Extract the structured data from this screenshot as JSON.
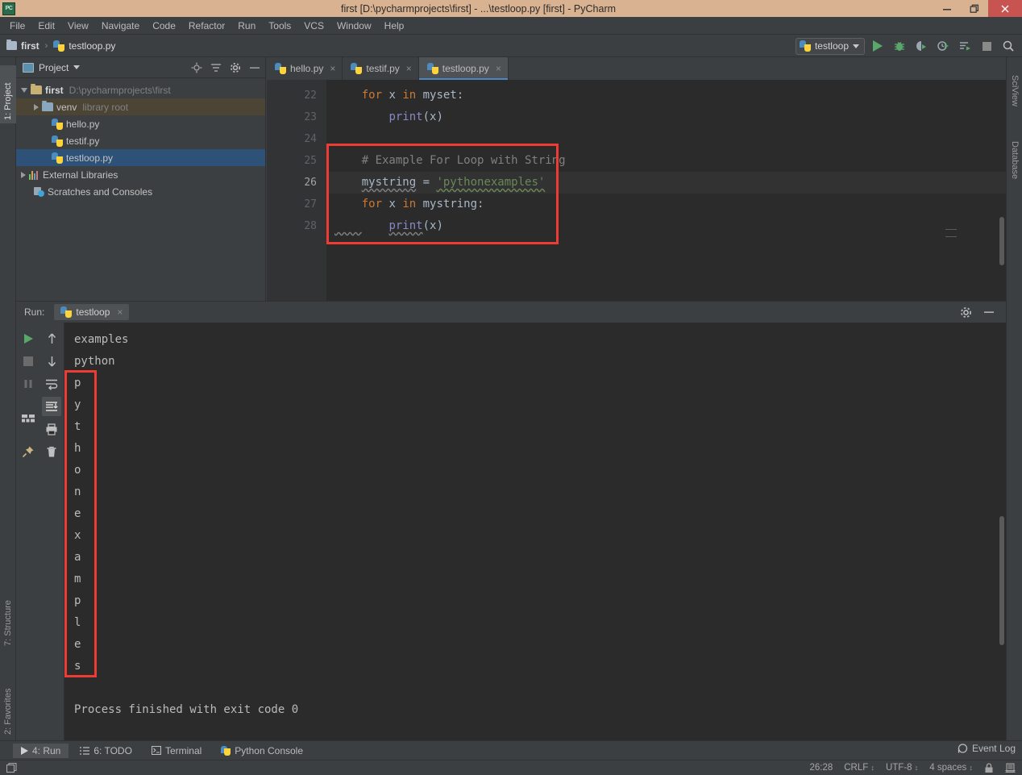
{
  "window": {
    "title": "first [D:\\pycharmprojects\\first] - ...\\testloop.py [first] - PyCharm",
    "app_icon_text": "PC",
    "controls": {
      "minimize": "minimize-icon",
      "restore": "restore-icon",
      "close": "close-icon"
    },
    "close_color": "#c75450",
    "titlebar_color": "#d9b391"
  },
  "menu": [
    {
      "label": "File"
    },
    {
      "label": "Edit"
    },
    {
      "label": "View"
    },
    {
      "label": "Navigate"
    },
    {
      "label": "Code"
    },
    {
      "label": "Refactor"
    },
    {
      "label": "Run"
    },
    {
      "label": "Tools"
    },
    {
      "label": "VCS"
    },
    {
      "label": "Window"
    },
    {
      "label": "Help"
    }
  ],
  "navbar": {
    "breadcrumb": [
      {
        "label": "first",
        "icon": "folder-icon"
      },
      {
        "label": "testloop.py",
        "icon": "python-file-icon"
      }
    ],
    "separator": "›",
    "run_config": {
      "label": "testloop",
      "icon": "python-icon",
      "caret": "chevron-down-icon"
    },
    "actions": [
      {
        "name": "run-button",
        "icon": "run-icon"
      },
      {
        "name": "debug-button",
        "icon": "debug-icon"
      },
      {
        "name": "run-with-coverage-button",
        "icon": "coverage-icon"
      },
      {
        "name": "profile-button",
        "icon": "profile-icon"
      },
      {
        "name": "run-tests-button",
        "icon": "run-tests-icon"
      },
      {
        "name": "stop-button",
        "icon": "stop-icon"
      },
      {
        "name": "search-everywhere-button",
        "icon": "search-icon"
      }
    ]
  },
  "left_stripe": [
    {
      "label": "1: Project",
      "selected": true
    },
    {
      "label": "7: Structure",
      "selected": false
    },
    {
      "label": "2: Favorites",
      "selected": false
    }
  ],
  "right_stripe": [
    {
      "label": "SciView"
    },
    {
      "label": "Database"
    }
  ],
  "project_panel": {
    "title": "Project",
    "caret": "chevron-down-icon",
    "actions": [
      "locate-icon",
      "collapse-all-icon",
      "settings-icon",
      "hide-icon"
    ],
    "tree": [
      {
        "name": "first",
        "sub": "D:\\pycharmprojects\\first",
        "depth": 0,
        "arrow": "down",
        "icon": "folder-icon",
        "bold": true,
        "state": "none"
      },
      {
        "name": "venv",
        "sub": "library root",
        "depth": 1,
        "arrow": "right",
        "icon": "folder-blue-icon",
        "bold": false,
        "state": "highlight"
      },
      {
        "name": "hello.py",
        "sub": "",
        "depth": 2,
        "arrow": "none",
        "icon": "python-file-icon",
        "bold": false,
        "state": "none"
      },
      {
        "name": "testif.py",
        "sub": "",
        "depth": 2,
        "arrow": "none",
        "icon": "python-file-icon",
        "bold": false,
        "state": "none"
      },
      {
        "name": "testloop.py",
        "sub": "",
        "depth": 2,
        "arrow": "none",
        "icon": "python-file-icon",
        "bold": false,
        "state": "selected"
      },
      {
        "name": "External Libraries",
        "sub": "",
        "depth": 0,
        "arrow": "right",
        "icon": "library-icon",
        "bold": false,
        "state": "none"
      },
      {
        "name": "Scratches and Consoles",
        "sub": "",
        "depth": 0,
        "arrow": "none",
        "icon": "scratches-icon",
        "bold": false,
        "state": "none"
      }
    ]
  },
  "editor": {
    "tabs": [
      {
        "label": "hello.py",
        "active": false,
        "close": "×"
      },
      {
        "label": "testif.py",
        "active": false,
        "close": "×"
      },
      {
        "label": "testloop.py",
        "active": true,
        "close": "×"
      }
    ],
    "line_numbers": [
      "22",
      "23",
      "24",
      "25",
      "26",
      "27",
      "28"
    ],
    "lines": [
      {
        "num": "22",
        "current": false,
        "tokens": [
          {
            "t": "    ",
            "c": ""
          },
          {
            "t": "for",
            "c": "kw"
          },
          {
            "t": " x ",
            "c": ""
          },
          {
            "t": "in",
            "c": "kw"
          },
          {
            "t": " myset:",
            "c": ""
          }
        ]
      },
      {
        "num": "23",
        "current": false,
        "tokens": [
          {
            "t": "        ",
            "c": ""
          },
          {
            "t": "print",
            "c": "fn"
          },
          {
            "t": "(x)",
            "c": ""
          }
        ]
      },
      {
        "num": "24",
        "current": false,
        "tokens": [
          {
            "t": "",
            "c": ""
          }
        ]
      },
      {
        "num": "25",
        "current": false,
        "tokens": [
          {
            "t": "    ",
            "c": ""
          },
          {
            "t": "# Example For Loop with String",
            "c": "cmt"
          }
        ]
      },
      {
        "num": "26",
        "current": true,
        "tokens": [
          {
            "t": "    ",
            "c": ""
          },
          {
            "t": "mystring",
            "c": "squig"
          },
          {
            "t": " = ",
            "c": ""
          },
          {
            "t": "'pythonexamples'",
            "c": "str-squig"
          }
        ]
      },
      {
        "num": "27",
        "current": false,
        "tokens": [
          {
            "t": "    ",
            "c": ""
          },
          {
            "t": "for",
            "c": "kw"
          },
          {
            "t": " x ",
            "c": ""
          },
          {
            "t": "in",
            "c": "kw"
          },
          {
            "t": " mystring:",
            "c": ""
          }
        ]
      },
      {
        "num": "28",
        "current": false,
        "tokens": [
          {
            "t": "        ",
            "c": ""
          },
          {
            "t": "print",
            "c": "fn-squig"
          },
          {
            "t": "(x)",
            "c": ""
          }
        ]
      }
    ],
    "annotation_box_color": "#ee3b33"
  },
  "run_panel": {
    "label": "Run:",
    "tab": {
      "label": "testloop",
      "icon": "python-icon",
      "close": "×"
    },
    "header_actions": [
      "settings-icon",
      "hide-icon"
    ],
    "tools_left": [
      {
        "name": "rerun-button",
        "icon": "rerun-icon"
      },
      {
        "name": "stop-button",
        "icon": "stop-icon"
      },
      {
        "name": "pause-button",
        "icon": "pause-icon"
      },
      {
        "name": "layout-button",
        "icon": "layout-icon"
      },
      {
        "name": "pin-tab-button",
        "icon": "pin-icon"
      }
    ],
    "tools_right": [
      {
        "name": "up-the-stack-button",
        "icon": "arrow-up-icon"
      },
      {
        "name": "down-the-stack-button",
        "icon": "arrow-down-icon"
      },
      {
        "name": "soft-wrap-button",
        "icon": "soft-wrap-icon"
      },
      {
        "name": "scroll-to-end-button",
        "icon": "scroll-to-end-icon",
        "active": true
      },
      {
        "name": "print-button",
        "icon": "print-icon"
      },
      {
        "name": "clear-all-button",
        "icon": "trash-icon"
      }
    ],
    "console_lines": [
      "examples",
      "python",
      "p",
      "y",
      "t",
      "h",
      "o",
      "n",
      "e",
      "x",
      "a",
      "m",
      "p",
      "l",
      "e",
      "s",
      "",
      "Process finished with exit code 0"
    ],
    "annotation_box_color": "#ee3b33"
  },
  "bottom_bar": [
    {
      "label": "4: Run",
      "mnemonic": "4",
      "icon": "run-icon",
      "selected": true
    },
    {
      "label": "6: TODO",
      "mnemonic": "6",
      "icon": "todo-icon",
      "selected": false
    },
    {
      "label": "Terminal",
      "mnemonic": "",
      "icon": "terminal-icon",
      "selected": false
    },
    {
      "label": "Python Console",
      "mnemonic": "",
      "icon": "python-console-icon",
      "selected": false
    }
  ],
  "event_log": {
    "label": "Event Log",
    "icon": "event-log-icon"
  },
  "status_bar": {
    "left_icon": "show-tool-windows-icon",
    "caret_position": "26:28",
    "line_separator": "CRLF",
    "encoding": "UTF-8",
    "indent": "4 spaces",
    "updown": "↕",
    "lock_icon": "lock-icon",
    "inspection_icon": "inspection-icon"
  }
}
